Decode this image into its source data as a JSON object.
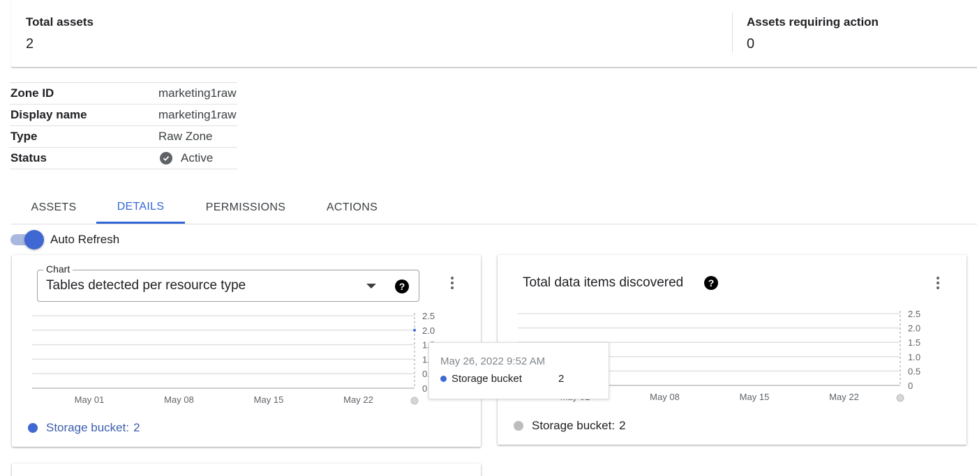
{
  "summary": {
    "total_assets_label": "Total assets",
    "total_assets_value": "2",
    "requiring_action_label": "Assets requiring action",
    "requiring_action_value": "0"
  },
  "details": [
    {
      "key": "Zone ID",
      "value": "marketing1raw"
    },
    {
      "key": "Display name",
      "value": "marketing1raw"
    },
    {
      "key": "Type",
      "value": "Raw Zone"
    },
    {
      "key": "Status",
      "value": "Active",
      "icon": "check-circle-icon"
    }
  ],
  "tabs": [
    {
      "label": "ASSETS",
      "active": false
    },
    {
      "label": "DETAILS",
      "active": true
    },
    {
      "label": "PERMISSIONS",
      "active": false
    },
    {
      "label": "ACTIONS",
      "active": false
    }
  ],
  "auto_refresh": {
    "label": "Auto Refresh",
    "on": true
  },
  "colors": {
    "accent": "#3367d6",
    "series_blue": "#3f68d2",
    "series_grey": "#bdbdbd"
  },
  "card1": {
    "select_legend": "Chart",
    "select_value": "Tables detected per resource type",
    "help_icon": "?",
    "legend_label": "Storage bucket:",
    "legend_value": "2"
  },
  "card2": {
    "title": "Total data items discovered",
    "help_icon": "?",
    "legend_label": "Storage bucket:",
    "legend_value": "2"
  },
  "tooltip": {
    "date": "May 26, 2022 9:52 AM",
    "series": "Storage bucket",
    "value": "2"
  },
  "chart_data": [
    {
      "type": "line",
      "title": "Tables detected per resource type",
      "x": [
        "May 01",
        "May 08",
        "May 15",
        "May 22"
      ],
      "y_ticks": [
        "2.5",
        "2.0",
        "1.5",
        "1.0",
        "0.5",
        "0"
      ],
      "ylim": [
        0,
        2.5
      ],
      "series": [
        {
          "name": "Storage bucket",
          "values": [
            {
              "x": "May 26, 2022 9:52 AM",
              "y": 2
            }
          ]
        }
      ],
      "grid": true,
      "legend": "bottom-left"
    },
    {
      "type": "line",
      "title": "Total data items discovered",
      "x": [
        "May 01",
        "May 08",
        "May 15",
        "May 22"
      ],
      "y_ticks": [
        "2.5",
        "2.0",
        "1.5",
        "1.0",
        "0.5",
        "0"
      ],
      "ylim": [
        0,
        2.5
      ],
      "series": [
        {
          "name": "Storage bucket",
          "values": []
        }
      ],
      "grid": true,
      "legend": "bottom-left"
    }
  ]
}
